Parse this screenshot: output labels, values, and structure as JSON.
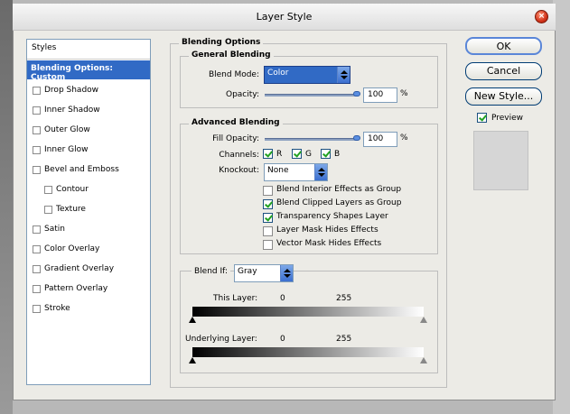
{
  "window": {
    "title": "Layer Style",
    "close": "×"
  },
  "styles_panel": {
    "header": "Styles",
    "selected": "Blending Options: Custom",
    "items": [
      {
        "label": "Drop Shadow",
        "indent": false
      },
      {
        "label": "Inner Shadow",
        "indent": false
      },
      {
        "label": "Outer Glow",
        "indent": false
      },
      {
        "label": "Inner Glow",
        "indent": false
      },
      {
        "label": "Bevel and Emboss",
        "indent": false
      },
      {
        "label": "Contour",
        "indent": true
      },
      {
        "label": "Texture",
        "indent": true
      },
      {
        "label": "Satin",
        "indent": false
      },
      {
        "label": "Color Overlay",
        "indent": false
      },
      {
        "label": "Gradient Overlay",
        "indent": false
      },
      {
        "label": "Pattern Overlay",
        "indent": false
      },
      {
        "label": "Stroke",
        "indent": false
      }
    ]
  },
  "blending_options": {
    "title": "Blending Options",
    "general": {
      "title": "General Blending",
      "blend_mode_label": "Blend Mode:",
      "blend_mode_value": "Color",
      "opacity_label": "Opacity:",
      "opacity_value": "100",
      "percent": "%"
    },
    "advanced": {
      "title": "Advanced Blending",
      "fill_opacity_label": "Fill Opacity:",
      "fill_opacity_value": "100",
      "percent": "%",
      "channels_label": "Channels:",
      "channel_r": "R",
      "channel_g": "G",
      "channel_b": "B",
      "knockout_label": "Knockout:",
      "knockout_value": "None",
      "options": [
        {
          "label": "Blend Interior Effects as Group",
          "checked": false
        },
        {
          "label": "Blend Clipped Layers as Group",
          "checked": true
        },
        {
          "label": "Transparency Shapes Layer",
          "checked": true
        },
        {
          "label": "Layer Mask Hides Effects",
          "checked": false
        },
        {
          "label": "Vector Mask Hides Effects",
          "checked": false
        }
      ]
    },
    "blend_if": {
      "label": "Blend If:",
      "value": "Gray",
      "this_layer_label": "This Layer:",
      "this_layer_min": "0",
      "this_layer_max": "255",
      "underlying_label": "Underlying Layer:",
      "underlying_min": "0",
      "underlying_max": "255"
    }
  },
  "buttons": {
    "ok": "OK",
    "cancel": "Cancel",
    "new_style": "New Style..."
  },
  "preview": {
    "label": "Preview",
    "checked": true
  },
  "colors": {
    "selection": "#316ac5",
    "dialog_bg": "#ecebe6"
  }
}
